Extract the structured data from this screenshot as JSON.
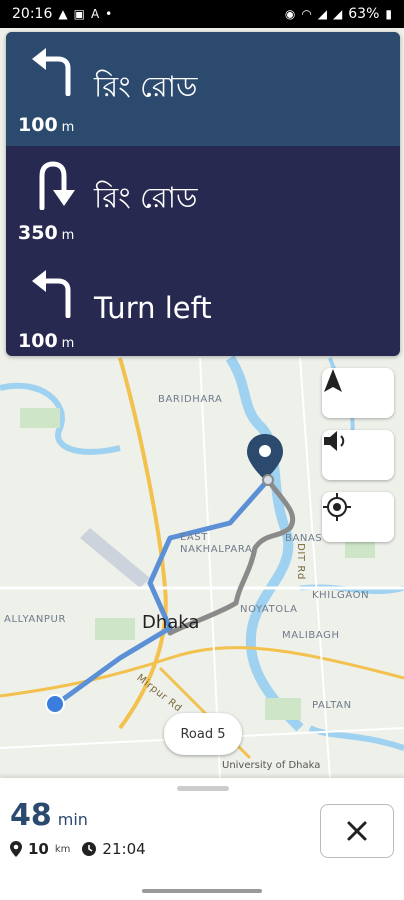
{
  "status_bar": {
    "time": "20:16",
    "battery": "63%",
    "left_icons": [
      "navigation-icon",
      "image-icon",
      "font-icon",
      "dot-icon"
    ],
    "right_icons": [
      "location-icon",
      "wifi-icon",
      "signal-icon",
      "signal-icon",
      "battery-icon"
    ]
  },
  "instructions": [
    {
      "icon": "turn-left-arrow-icon",
      "distance": "100",
      "unit": "m",
      "street": "রিং রোড"
    },
    {
      "icon": "u-turn-arrow-icon",
      "distance": "350",
      "unit": "m",
      "street": "রিং রোড"
    },
    {
      "icon": "turn-left-arrow-icon",
      "distance": "100",
      "unit": "m",
      "street": "Turn left"
    }
  ],
  "map": {
    "labels": {
      "baridhara": "BARIDHARA",
      "east_nakhalpara": "EAST\nNAKHALPARA",
      "banasree": "BANAS",
      "dit_rd": "DIT Rd",
      "khilgaon": "KHILGAON",
      "noyatola": "NOYATOLA",
      "dhaka": "Dhaka",
      "malibagh": "MALIBAGH",
      "kallyanpur": "ALLYANPUR",
      "mirpur_rd": "Mirpur Rd",
      "paltan": "PALTAN",
      "university": "University of Dhaka"
    },
    "colors": {
      "route_active": "#5b8fd6",
      "route_alt": "#8a8a8a",
      "water": "#9fd2f0",
      "major_road": "#f2c14e",
      "destination_pin": "#2c4a6e",
      "origin_dot": "#3b7ddd"
    }
  },
  "map_controls": [
    {
      "name": "compass-button",
      "icon": "compass-arrow-icon"
    },
    {
      "name": "sound-button",
      "icon": "speaker-icon"
    },
    {
      "name": "recenter-button",
      "icon": "crosshair-icon"
    }
  ],
  "road_chip": "Road 5",
  "trip": {
    "duration": "48",
    "duration_unit": "min",
    "distance": "10",
    "distance_unit": "km",
    "arrival": "21:04"
  },
  "close_button_icon": "close-icon"
}
